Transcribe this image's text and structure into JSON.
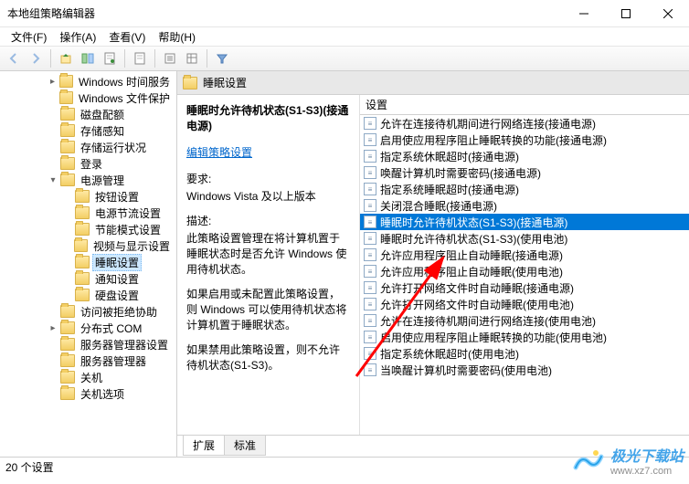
{
  "window": {
    "title": "本地组策略编辑器"
  },
  "menu": {
    "file": "文件(F)",
    "action": "操作(A)",
    "view": "查看(V)",
    "help": "帮助(H)"
  },
  "tree": {
    "items": [
      {
        "label": "Windows 时间服务",
        "indent": 3,
        "twisty": "▸"
      },
      {
        "label": "Windows 文件保护",
        "indent": 3,
        "twisty": ""
      },
      {
        "label": "磁盘配额",
        "indent": 3,
        "twisty": ""
      },
      {
        "label": "存储感知",
        "indent": 3,
        "twisty": ""
      },
      {
        "label": "存储运行状况",
        "indent": 3,
        "twisty": ""
      },
      {
        "label": "登录",
        "indent": 3,
        "twisty": ""
      },
      {
        "label": "电源管理",
        "indent": 3,
        "twisty": "▾"
      },
      {
        "label": "按钮设置",
        "indent": 4,
        "twisty": ""
      },
      {
        "label": "电源节流设置",
        "indent": 4,
        "twisty": ""
      },
      {
        "label": "节能模式设置",
        "indent": 4,
        "twisty": ""
      },
      {
        "label": "视频与显示设置",
        "indent": 4,
        "twisty": ""
      },
      {
        "label": "睡眠设置",
        "indent": 4,
        "twisty": "",
        "selected": true
      },
      {
        "label": "通知设置",
        "indent": 4,
        "twisty": ""
      },
      {
        "label": "硬盘设置",
        "indent": 4,
        "twisty": ""
      },
      {
        "label": "访问被拒绝协助",
        "indent": 3,
        "twisty": ""
      },
      {
        "label": "分布式 COM",
        "indent": 3,
        "twisty": "▸"
      },
      {
        "label": "服务器管理器设置",
        "indent": 3,
        "twisty": ""
      },
      {
        "label": "服务器管理器",
        "indent": 3,
        "twisty": ""
      },
      {
        "label": "关机",
        "indent": 3,
        "twisty": ""
      },
      {
        "label": "关机选项",
        "indent": 3,
        "twisty": ""
      }
    ]
  },
  "right": {
    "header": "睡眠设置",
    "desc": {
      "title": "睡眠时允许待机状态(S1-S3)(接通电源)",
      "edit_link": "编辑策略设置",
      "req_label": "要求:",
      "req_text": "Windows Vista 及以上版本",
      "desc_label": "描述:",
      "desc_text1": "此策略设置管理在将计算机置于睡眠状态时是否允许 Windows 使用待机状态。",
      "desc_text2": "如果启用或未配置此策略设置，则 Windows 可以使用待机状态将计算机置于睡眠状态。",
      "desc_text3": "如果禁用此策略设置，则不允许待机状态(S1-S3)。"
    },
    "col_header": "设置",
    "settings": [
      "允许在连接待机期间进行网络连接(接通电源)",
      "启用使应用程序阻止睡眠转换的功能(接通电源)",
      "指定系统休眠超时(接通电源)",
      "唤醒计算机时需要密码(接通电源)",
      "指定系统睡眠超时(接通电源)",
      "关闭混合睡眠(接通电源)",
      "睡眠时允许待机状态(S1-S3)(接通电源)",
      "睡眠时允许待机状态(S1-S3)(使用电池)",
      "允许应用程序阻止自动睡眠(接通电源)",
      "允许应用程序阻止自动睡眠(使用电池)",
      "允许打开网络文件时自动睡眠(接通电源)",
      "允许打开网络文件时自动睡眠(使用电池)",
      "允许在连接待机期间进行网络连接(使用电池)",
      "启用使应用程序阻止睡眠转换的功能(使用电池)",
      "指定系统休眠超时(使用电池)",
      "当唤醒计算机时需要密码(使用电池)"
    ],
    "selected_index": 6
  },
  "tabs": {
    "extended": "扩展",
    "standard": "标准"
  },
  "status": "20 个设置",
  "watermark": {
    "name": "极光下载站",
    "url": "www.xz7.com"
  }
}
